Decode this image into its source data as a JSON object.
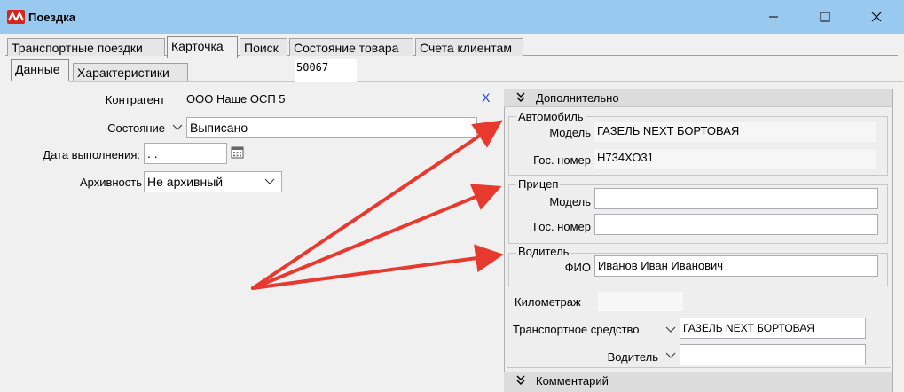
{
  "window": {
    "title": "Поездка"
  },
  "tabs_top": [
    "Транспортные поездки",
    "Карточка",
    "Поиск",
    "Состояние товара",
    "Счета клиентам"
  ],
  "tabs_sub": [
    "Данные",
    "Характеристики"
  ],
  "record_number": "50067",
  "form": {
    "contractor_label": "Контрагент",
    "contractor_value": "ООО Наше ОСП 5",
    "clear_symbol": "X",
    "state_label": "Состояние",
    "state_value": "Выписано",
    "date_label": "Дата выполнения:",
    "date_value": " .  .",
    "archive_label": "Архивность",
    "archive_value": "Не архивный"
  },
  "panel": {
    "header": "Дополнительно",
    "car_group": "Автомобиль",
    "car_model_label": "Модель",
    "car_model_value": "ГАЗЕЛЬ NEXT БОРТОВАЯ",
    "car_plate_label": "Гос. номер",
    "car_plate_value": "Н734ХО31",
    "trailer_group": "Прицеп",
    "trailer_model_label": "Модель",
    "trailer_model_value": "",
    "trailer_plate_label": "Гос. номер",
    "trailer_plate_value": "",
    "driver_group": "Водитель",
    "driver_name_label": "ФИО",
    "driver_name_value": "Иванов Иван Иванович",
    "mileage_label": "Километраж",
    "mileage_value": "",
    "vehicle_label": "Транспортное средство",
    "vehicle_value": "ГАЗЕЛЬ NEXT БОРТОВАЯ",
    "driver_label": "Водитель",
    "driver_value": "",
    "comment_header": "Комментарий"
  },
  "colors": {
    "titlebar": "#99c9ef",
    "arrow": "#e8392f",
    "clear": "#1f3fd1"
  }
}
